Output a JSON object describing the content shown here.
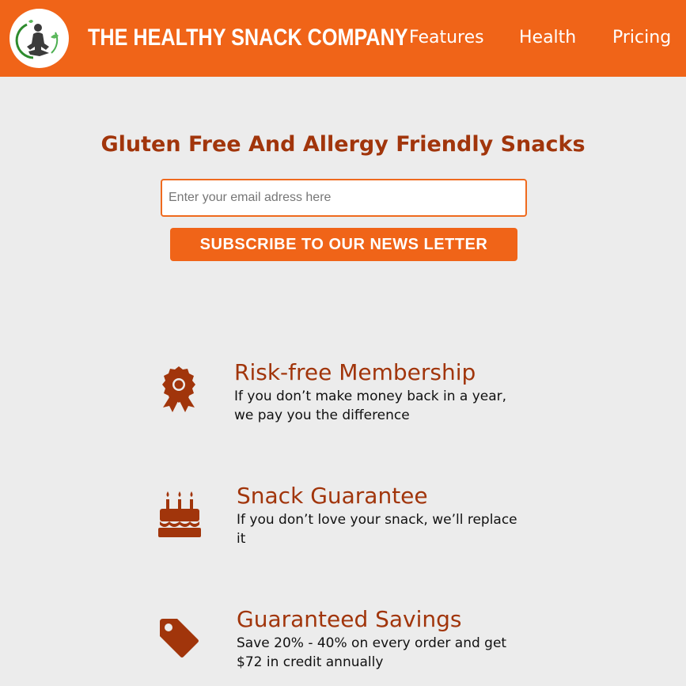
{
  "header": {
    "brand": "THE HEALTHY SNACK COMPANY",
    "logo_icon": "meditating-figure-logo",
    "nav": [
      {
        "label": "Features"
      },
      {
        "label": "Health"
      },
      {
        "label": "Pricing"
      }
    ]
  },
  "hero": {
    "title": "Gluten Free And Allergy Friendly Snacks",
    "email_placeholder": "Enter your email adress here",
    "email_value": "",
    "subscribe_label": "SUBSCRIBE TO OUR NEWS LETTER"
  },
  "features": [
    {
      "icon": "award-ribbon-icon",
      "title": "Risk-free Membership",
      "description": "If you don’t make money back in a year, we pay you the difference"
    },
    {
      "icon": "birthday-cake-icon",
      "title": "Snack Guarantee",
      "description": "If you don’t love your snack, we’ll replace it"
    },
    {
      "icon": "price-tag-icon",
      "title": "Guaranteed Savings",
      "description": "Save 20% - 40% on every order and get $72 in credit annually"
    }
  ],
  "colors": {
    "accent": "#f06418",
    "heading": "#a1350b",
    "background": "#ececec"
  }
}
